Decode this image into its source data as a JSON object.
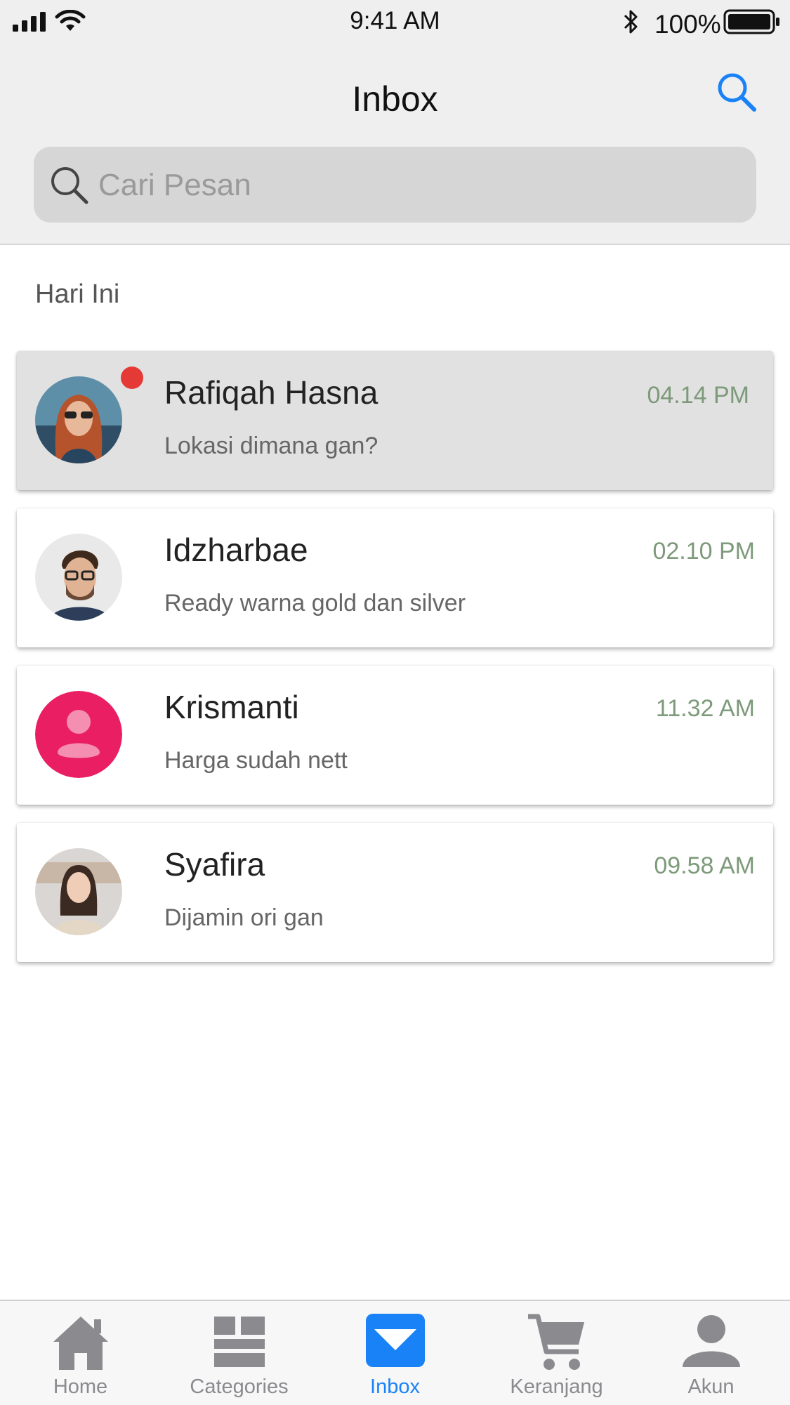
{
  "status_bar": {
    "time": "9:41 AM",
    "battery": "100%"
  },
  "header": {
    "title": "Inbox",
    "search_icon": "search-icon"
  },
  "search": {
    "placeholder": "Cari Pesan",
    "value": ""
  },
  "section_label": "Hari Ini",
  "conversations": [
    {
      "name": "Rafiqah Hasna",
      "message": "Lokasi dimana gan?",
      "time": "04.14 PM",
      "unread": true,
      "avatar": "photo-woman-red-hair"
    },
    {
      "name": "Idzharbae",
      "message": "Ready warna gold dan silver",
      "time": "02.10 PM",
      "unread": false,
      "avatar": "photo-man-glasses"
    },
    {
      "name": "Krismanti",
      "message": "Harga sudah nett",
      "time": "11.32 AM",
      "unread": false,
      "avatar": "person-placeholder"
    },
    {
      "name": "Syafira",
      "message": "Dijamin ori gan",
      "time": "09.58 AM",
      "unread": false,
      "avatar": "photo-woman"
    }
  ],
  "tab_bar": {
    "active": "Inbox",
    "tabs": [
      {
        "label": "Home",
        "icon": "home-icon"
      },
      {
        "label": "Categories",
        "icon": "categories-icon"
      },
      {
        "label": "Inbox",
        "icon": "mail-icon"
      },
      {
        "label": "Keranjang",
        "icon": "cart-icon"
      },
      {
        "label": "Akun",
        "icon": "person-icon"
      }
    ]
  },
  "colors": {
    "accent": "#1a82f7",
    "unread_dot": "#e53935",
    "time_text": "#7d9a7a",
    "placeholder_avatar": "#e91e63",
    "header_bg": "#efefef",
    "search_bg": "#d6d6d6",
    "active_row_bg": "#e1e1e1"
  }
}
